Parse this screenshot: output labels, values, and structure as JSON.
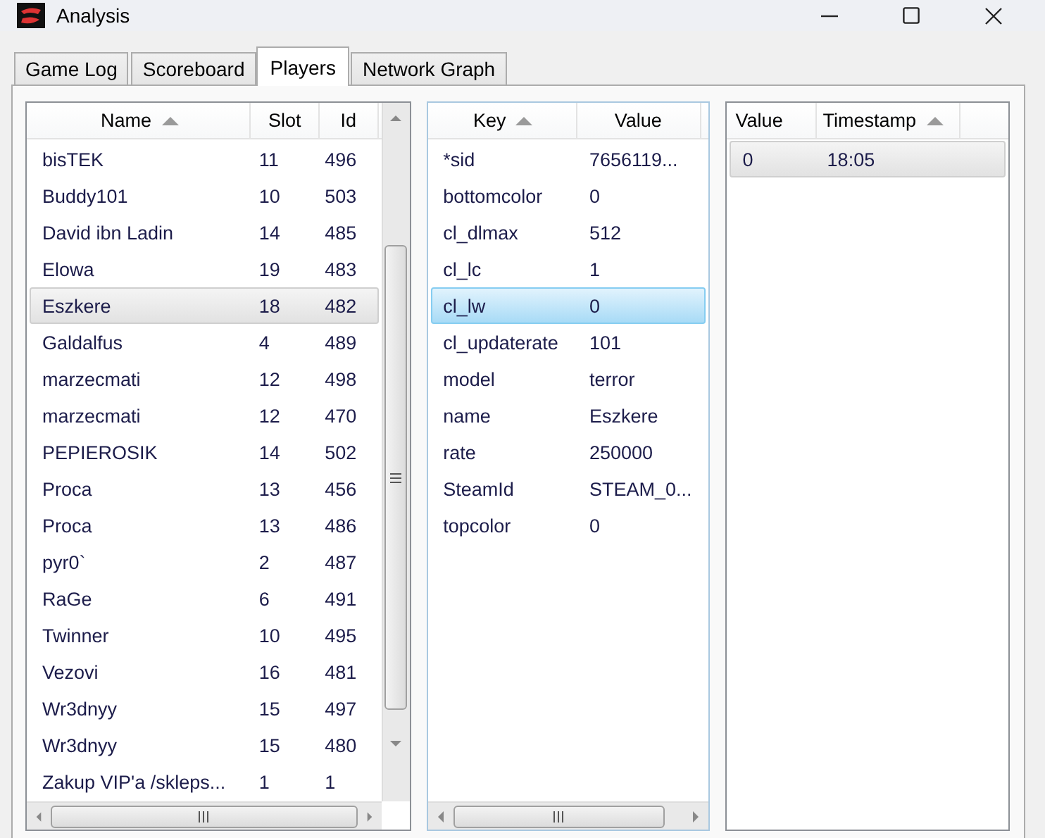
{
  "window": {
    "title": "Analysis"
  },
  "tabs": [
    {
      "label": "Game Log",
      "selected": false
    },
    {
      "label": "Scoreboard",
      "selected": false
    },
    {
      "label": "Players",
      "selected": true
    },
    {
      "label": "Network Graph",
      "selected": false
    }
  ],
  "players": {
    "columns": [
      {
        "label": "Name",
        "sorted": true
      },
      {
        "label": "Slot",
        "sorted": false
      },
      {
        "label": "Id",
        "sorted": false
      }
    ],
    "rows": [
      {
        "name": "bisTEK",
        "slot": "11",
        "id": "496",
        "selected": false
      },
      {
        "name": "Buddy101",
        "slot": "10",
        "id": "503",
        "selected": false
      },
      {
        "name": "David ibn Ladin",
        "slot": "14",
        "id": "485",
        "selected": false
      },
      {
        "name": "Elowa",
        "slot": "19",
        "id": "483",
        "selected": false
      },
      {
        "name": "Eszkere",
        "slot": "18",
        "id": "482",
        "selected": true
      },
      {
        "name": "Galdalfus",
        "slot": "4",
        "id": "489",
        "selected": false
      },
      {
        "name": "marzecmati",
        "slot": "12",
        "id": "498",
        "selected": false
      },
      {
        "name": "marzecmati",
        "slot": "12",
        "id": "470",
        "selected": false
      },
      {
        "name": "PEPIEROSIK",
        "slot": "14",
        "id": "502",
        "selected": false
      },
      {
        "name": "Proca",
        "slot": "13",
        "id": "456",
        "selected": false
      },
      {
        "name": "Proca",
        "slot": "13",
        "id": "486",
        "selected": false
      },
      {
        "name": "pyr0`",
        "slot": "2",
        "id": "487",
        "selected": false
      },
      {
        "name": "RaGe",
        "slot": "6",
        "id": "491",
        "selected": false
      },
      {
        "name": "Twinner",
        "slot": "10",
        "id": "495",
        "selected": false
      },
      {
        "name": "Vezovi",
        "slot": "16",
        "id": "481",
        "selected": false
      },
      {
        "name": "Wr3dnyy",
        "slot": "15",
        "id": "497",
        "selected": false
      },
      {
        "name": "Wr3dnyy",
        "slot": "15",
        "id": "480",
        "selected": false
      },
      {
        "name": "Zakup VIP'a /skleps...",
        "slot": "1",
        "id": "1",
        "selected": false
      }
    ]
  },
  "properties": {
    "columns": [
      {
        "label": "Key",
        "sorted": true
      },
      {
        "label": "Value",
        "sorted": false
      }
    ],
    "rows": [
      {
        "key": "*sid",
        "value": "7656119...",
        "selected": false
      },
      {
        "key": "bottomcolor",
        "value": "0",
        "selected": false
      },
      {
        "key": "cl_dlmax",
        "value": "512",
        "selected": false
      },
      {
        "key": "cl_lc",
        "value": "1",
        "selected": false
      },
      {
        "key": "cl_lw",
        "value": "0",
        "selected": true
      },
      {
        "key": "cl_updaterate",
        "value": "101",
        "selected": false
      },
      {
        "key": "model",
        "value": "terror",
        "selected": false
      },
      {
        "key": "name",
        "value": "Eszkere",
        "selected": false
      },
      {
        "key": "rate",
        "value": "250000",
        "selected": false
      },
      {
        "key": "SteamId",
        "value": "STEAM_0...",
        "selected": false
      },
      {
        "key": "topcolor",
        "value": "0",
        "selected": false
      }
    ]
  },
  "history": {
    "columns": [
      {
        "label": "Value",
        "sorted": false
      },
      {
        "label": "Timestamp",
        "sorted": true
      }
    ],
    "rows": [
      {
        "value": "0",
        "timestamp": "18:05",
        "selected": true
      }
    ]
  }
}
